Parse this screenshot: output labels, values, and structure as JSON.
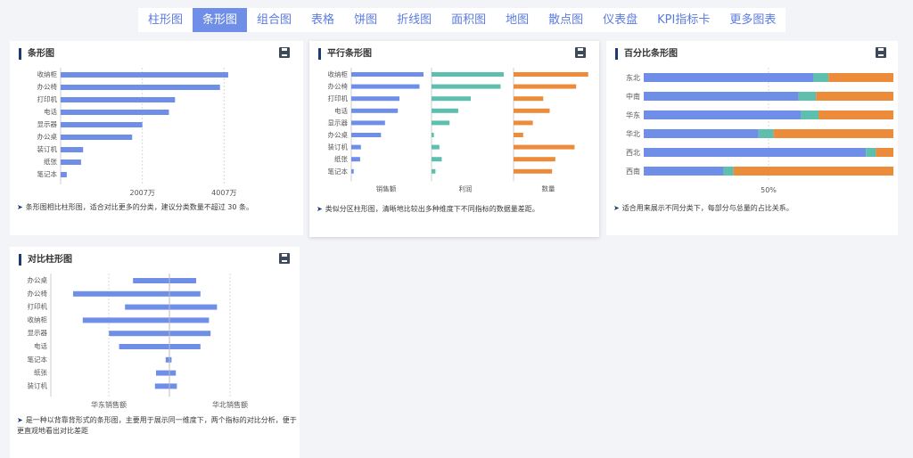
{
  "tabs": [
    "柱形图",
    "条形图",
    "组合图",
    "表格",
    "饼图",
    "折线图",
    "面积图",
    "地图",
    "散点图",
    "仪表盘",
    "KPI指标卡",
    "更多图表"
  ],
  "active_tab": 1,
  "colors": {
    "blue": "#6f8ee8",
    "teal": "#5fbfae",
    "orange": "#ec8b3a",
    "accent": "#1f3b73"
  },
  "cards": {
    "bar": {
      "title": "条形图",
      "desc": "条形图相比柱形图，适合对比更多的分类，建议分类数量不超过 30 条。"
    },
    "parallel": {
      "title": "平行条形图",
      "desc": "类似分区柱形图，清晰地比较出多种维度下不同指标的数据量差距。"
    },
    "percent": {
      "title": "百分比条形图",
      "desc": "适合用来展示不同分类下，每部分与总量的占比关系。"
    },
    "contrast": {
      "title": "对比柱形图",
      "desc": "是一种以背靠背形式的条形图，主要用于展示同一维度下，两个指标的对比分析，便于更直观地看出对比差距"
    }
  },
  "chart_data": [
    {
      "type": "bar",
      "categories": [
        "收纳柜",
        "办公椅",
        "打印机",
        "电话",
        "显示器",
        "办公桌",
        "装订机",
        "纸张",
        "笔记本"
      ],
      "values": [
        4100000,
        3900000,
        2800000,
        2650000,
        2000000,
        1750000,
        550000,
        500000,
        150000
      ],
      "xlim": [
        0,
        4800000
      ],
      "tick_labels": [
        "2007万",
        "4007万"
      ],
      "ticks": [
        2000000,
        4000000
      ]
    },
    {
      "type": "bar",
      "categories": [
        "收纳柜",
        "办公椅",
        "打印机",
        "电话",
        "显示器",
        "办公桌",
        "装订机",
        "纸张",
        "笔记本"
      ],
      "series": [
        {
          "name": "销售额",
          "values": [
            0.9,
            0.85,
            0.6,
            0.58,
            0.42,
            0.37,
            0.12,
            0.11,
            0.03
          ]
        },
        {
          "name": "利润",
          "values": [
            0.92,
            0.88,
            0.5,
            0.34,
            0.23,
            0.03,
            0.1,
            0.13,
            0.05
          ]
        },
        {
          "name": "数量",
          "values": [
            0.93,
            0.78,
            0.37,
            0.45,
            0.24,
            0.12,
            0.76,
            0.52,
            0.48
          ]
        }
      ],
      "axis_labels": [
        "销售额",
        "利润",
        "数量"
      ]
    },
    {
      "type": "bar",
      "categories": [
        "东北",
        "中南",
        "华东",
        "华北",
        "西北",
        "西南"
      ],
      "series": [
        {
          "values": [
            68,
            62,
            63,
            46,
            89,
            32
          ]
        },
        {
          "values": [
            6,
            7,
            7,
            6,
            4,
            4
          ]
        },
        {
          "values": [
            26,
            31,
            30,
            48,
            7,
            64
          ]
        }
      ],
      "tick_labels": [
        "50%"
      ],
      "ticks": [
        50
      ]
    },
    {
      "type": "bar",
      "categories": [
        "办公桌",
        "办公椅",
        "打印机",
        "收纳柜",
        "显示器",
        "电话",
        "笔记本",
        "纸张",
        "装订机"
      ],
      "series": [
        {
          "name": "华东销售额",
          "values": [
            0.68,
            1.8,
            0.83,
            1.62,
            1.13,
            0.94,
            0.07,
            0.25,
            0.27
          ]
        },
        {
          "name": "华北销售额",
          "values": [
            0.5,
            0.58,
            0.89,
            0.74,
            0.77,
            0.58,
            0.04,
            0.12,
            0.14
          ]
        }
      ]
    }
  ]
}
